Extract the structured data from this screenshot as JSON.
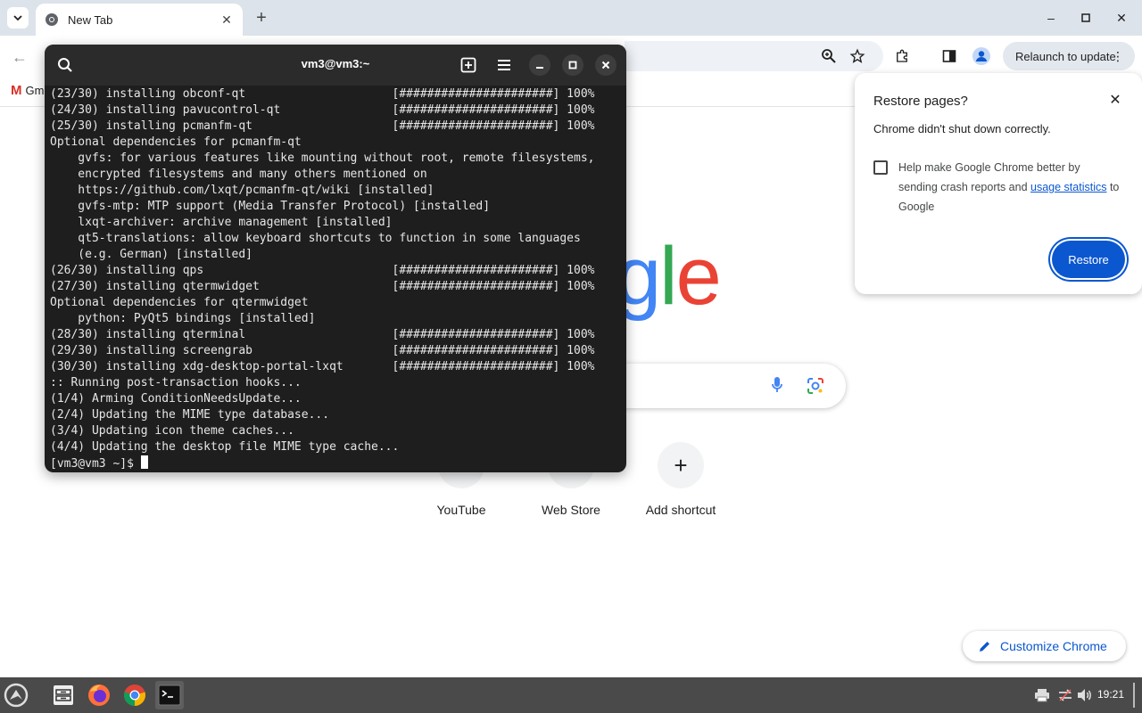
{
  "chrome": {
    "tab_title": "New Tab",
    "relaunch_label": "Relaunch to update",
    "bookmark_gmail": "Gm",
    "shortcuts": [
      {
        "label": "YouTube"
      },
      {
        "label": "Web Store"
      },
      {
        "label": "Add shortcut"
      }
    ],
    "customize_label": "Customize Chrome",
    "logo_partial": {
      "g": "g",
      "l": "l",
      "e": "e"
    }
  },
  "restore_bubble": {
    "title": "Restore pages?",
    "message": "Chrome didn't shut down correctly.",
    "help_text_pre": "Help make Google Chrome better by sending crash reports and ",
    "help_link": "usage statistics",
    "help_text_post": " to Google",
    "restore_button": "Restore"
  },
  "terminal": {
    "title": "vm3@vm3:~",
    "lines": [
      "(23/30) installing obconf-qt                     [######################] 100%",
      "(24/30) installing pavucontrol-qt                [######################] 100%",
      "(25/30) installing pcmanfm-qt                    [######################] 100%",
      "Optional dependencies for pcmanfm-qt",
      "    gvfs: for various features like mounting without root, remote filesystems,",
      "    encrypted filesystems and many others mentioned on",
      "    https://github.com/lxqt/pcmanfm-qt/wiki [installed]",
      "    gvfs-mtp: MTP support (Media Transfer Protocol) [installed]",
      "    lxqt-archiver: archive management [installed]",
      "    qt5-translations: allow keyboard shortcuts to function in some languages",
      "    (e.g. German) [installed]",
      "(26/30) installing qps                           [######################] 100%",
      "(27/30) installing qtermwidget                   [######################] 100%",
      "Optional dependencies for qtermwidget",
      "    python: PyQt5 bindings [installed]",
      "(28/30) installing qterminal                     [######################] 100%",
      "(29/30) installing screengrab                    [######################] 100%",
      "(30/30) installing xdg-desktop-portal-lxqt       [######################] 100%",
      ":: Running post-transaction hooks...",
      "(1/4) Arming ConditionNeedsUpdate...",
      "(2/4) Updating the MIME type database...",
      "(3/4) Updating icon theme caches...",
      "(4/4) Updating the desktop file MIME type cache..."
    ],
    "prompt": "[vm3@vm3 ~]$ "
  },
  "taskbar": {
    "clock": "19:21"
  },
  "colors": {
    "chrome_blue": "#0b57d0",
    "terminal_bg": "#1e1e1e",
    "taskbar_bg": "#4a4a4a"
  }
}
